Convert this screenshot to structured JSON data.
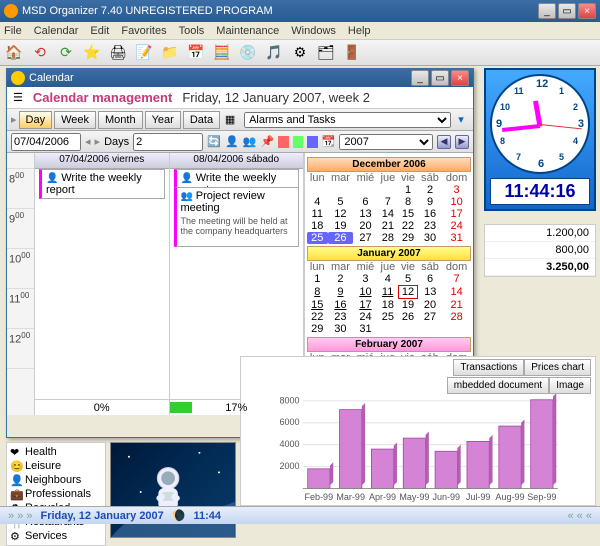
{
  "app": {
    "title": "MSD Organizer 7.40 UNREGISTERED PROGRAM"
  },
  "menu": [
    "File",
    "Calendar",
    "Edit",
    "Favorites",
    "Tools",
    "Maintenance",
    "Windows",
    "Help"
  ],
  "calwin": {
    "title": "Calendar",
    "mgmt": "Calendar management",
    "date": "Friday, 12 January 2007, week 2",
    "views": {
      "day": "Day",
      "week": "Week",
      "month": "Month",
      "year": "Year",
      "data": "Data"
    },
    "selector": "Alarms and Tasks",
    "opt_date": "07/04/2006",
    "days_lbl": "Days",
    "days_val": "2",
    "year_sel": "2007",
    "day1": {
      "hdr": "07/04/2006 viernes",
      "ev1": "Write the weekly report",
      "pct": "0%"
    },
    "day2": {
      "hdr": "08/04/2006 sábado",
      "ev1": "Write the weekly report",
      "ev2": "Project review meeting",
      "ev2_body": "The meeting will be held at the company headquarters",
      "pct": "17%"
    },
    "dow": [
      "lun",
      "mar",
      "mié",
      "jue",
      "vie",
      "sáb",
      "dom"
    ],
    "months": {
      "dec": "December 2006",
      "jan": "January 2007",
      "feb": "February 2007"
    }
  },
  "clock": {
    "time": "11:44:16"
  },
  "money": {
    "v1": "1.200,00",
    "v2": "800,00",
    "v3": "3.250,00"
  },
  "sidelist": [
    "Health",
    "Leisure",
    "Neighbours",
    "Professionals",
    "Recycled",
    "Restaurants",
    "Services"
  ],
  "chart": {
    "tabs": {
      "t1": "Transactions",
      "t2": "Prices chart"
    },
    "sub": {
      "s1": "mbedded document",
      "s2": "Image"
    }
  },
  "chart_data": {
    "type": "bar",
    "categories": [
      "Feb-99",
      "Mar-99",
      "Apr-99",
      "May-99",
      "Jun-99",
      "Jul-99",
      "Aug-99",
      "Sep-99"
    ],
    "values": [
      1800,
      7200,
      3600,
      4600,
      3400,
      4300,
      5700,
      8100
    ],
    "ylabel": "",
    "xlabel": "",
    "yticks": [
      2000,
      4000,
      6000,
      8000
    ],
    "ylim": [
      0,
      9000
    ]
  },
  "status": {
    "date": "Friday, 12 January 2007",
    "time": "11:44"
  }
}
